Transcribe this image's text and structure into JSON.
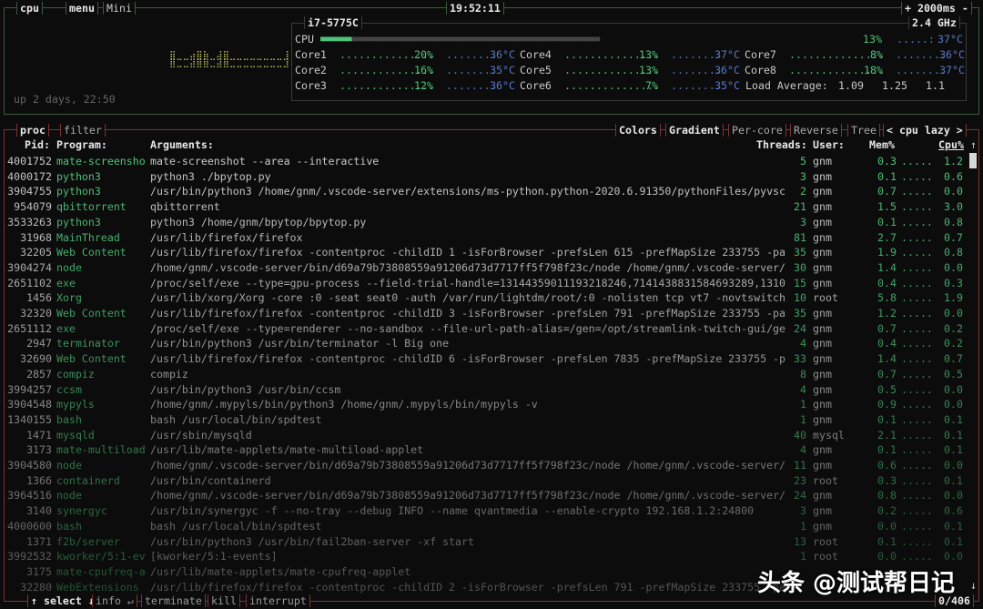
{
  "cpu_box": {
    "tab": "cpu",
    "menu": "menu",
    "mini": "Mini",
    "clock": "19:52:11",
    "interval": "+ 2000ms -",
    "uptime": "up 2 days, 22:50",
    "mini_graph": "⣿⣀⣀⣴⣿⣷⣀⣼⣿⣀⣀⣀⣀⣀⣀⣀⣀⣸"
  },
  "cpu_info": {
    "model": "i7-5775C",
    "freq": "2.4 GHz",
    "total": {
      "label": "CPU",
      "pct": "13%",
      "temp": "37°C",
      "bar_fill": 13
    },
    "cores": [
      {
        "label": "Core1",
        "pct": "20%",
        "temp": "36°C"
      },
      {
        "label": "Core2",
        "pct": "16%",
        "temp": "35°C"
      },
      {
        "label": "Core3",
        "pct": "12%",
        "temp": "36°C"
      },
      {
        "label": "Core4",
        "pct": "13%",
        "temp": "37°C"
      },
      {
        "label": "Core5",
        "pct": "13%",
        "temp": "36°C"
      },
      {
        "label": "Core6",
        "pct": "7%",
        "temp": "35°C"
      },
      {
        "label": "Core7",
        "pct": "8%",
        "temp": "36°C"
      },
      {
        "label": "Core8",
        "pct": "18%",
        "temp": "37°C"
      }
    ],
    "load_label": "Load Average:",
    "load": [
      "1.09",
      "1.25",
      "1.1"
    ]
  },
  "proc_box": {
    "tab": "proc",
    "filter": "filter",
    "options": [
      "Colors",
      "Gradient",
      "Per-core",
      "Reverse",
      "Tree"
    ],
    "sort": "< cpu lazy >",
    "headers": {
      "pid": "Pid:",
      "program": "Program:",
      "args": "Arguments:",
      "threads": "Threads:",
      "user": "User:",
      "mem": "Mem%",
      "cpu": "Cpu%",
      "sort_arrow": "↑"
    },
    "footer": {
      "select": "↑ select ↓",
      "info": "info ↵",
      "terminate": "terminate",
      "kill": "kill",
      "interrupt": "interrupt",
      "count": "0/406",
      "down_arrow": "↓"
    },
    "rows": [
      [
        "4001752",
        "mate-screensho",
        "mate-screenshot --area --interactive",
        "5",
        "gnm",
        "0.3",
        "1.2"
      ],
      [
        "4000172",
        "python3",
        "python3 ./bpytop.py",
        "3",
        "gnm",
        "0.1",
        "0.6"
      ],
      [
        "3904755",
        "python3",
        "/usr/bin/python3 /home/gnm/.vscode-server/extensions/ms-python.python-2020.6.91350/pythonFiles/pyvsc",
        "2",
        "gnm",
        "0.7",
        "0.0"
      ],
      [
        "954079",
        "qbittorrent",
        "qbittorrent",
        "21",
        "gnm",
        "1.5",
        "3.0"
      ],
      [
        "3533263",
        "python3",
        "python3 /home/gnm/bpytop/bpytop.py",
        "3",
        "gnm",
        "0.1",
        "0.8"
      ],
      [
        "31968",
        "MainThread",
        "/usr/lib/firefox/firefox",
        "81",
        "gnm",
        "2.7",
        "0.7"
      ],
      [
        "32205",
        "Web Content",
        "/usr/lib/firefox/firefox -contentproc -childID 1 -isForBrowser -prefsLen 615 -prefMapSize 233755 -pa",
        "35",
        "gnm",
        "1.9",
        "0.8"
      ],
      [
        "3904274",
        "node",
        "/home/gnm/.vscode-server/bin/d69a79b73808559a91206d73d7717ff5f798f23c/node /home/gnm/.vscode-server/",
        "30",
        "gnm",
        "1.4",
        "0.0"
      ],
      [
        "2651102",
        "exe",
        "/proc/self/exe --type=gpu-process --field-trial-handle=13144359011193218246,7141438831584693289,1310",
        "15",
        "gnm",
        "0.4",
        "0.3"
      ],
      [
        "1456",
        "Xorg",
        "/usr/lib/xorg/Xorg -core :0 -seat seat0 -auth /var/run/lightdm/root/:0 -nolisten tcp vt7 -novtswitch",
        "10",
        "root",
        "5.8",
        "1.9"
      ],
      [
        "32320",
        "Web Content",
        "/usr/lib/firefox/firefox -contentproc -childID 3 -isForBrowser -prefsLen 791 -prefMapSize 233755 -pa",
        "35",
        "gnm",
        "1.2",
        "0.0"
      ],
      [
        "2651112",
        "exe",
        "/proc/self/exe --type=renderer --no-sandbox --file-url-path-alias=/gen=/opt/streamlink-twitch-gui/ge",
        "24",
        "gnm",
        "0.7",
        "0.2"
      ],
      [
        "2947",
        "terminator",
        "/usr/bin/python3 /usr/bin/terminator -l Big one",
        "4",
        "gnm",
        "0.4",
        "0.2"
      ],
      [
        "32690",
        "Web Content",
        "/usr/lib/firefox/firefox -contentproc -childID 6 -isForBrowser -prefsLen 7835 -prefMapSize 233755 -p",
        "33",
        "gnm",
        "1.4",
        "0.7"
      ],
      [
        "2857",
        "compiz",
        "compiz",
        "8",
        "gnm",
        "0.7",
        "0.5"
      ],
      [
        "3994257",
        "ccsm",
        "/usr/bin/python3 /usr/bin/ccsm",
        "4",
        "gnm",
        "0.5",
        "0.0"
      ],
      [
        "3904548",
        "mypyls",
        "/home/gnm/.mypyls/bin/python3 /home/gnm/.mypyls/bin/mypyls -v",
        "1",
        "gnm",
        "0.9",
        "0.0"
      ],
      [
        "1340155",
        "bash",
        "bash /usr/local/bin/spdtest",
        "1",
        "gnm",
        "0.1",
        "0.1"
      ],
      [
        "1471",
        "mysqld",
        "/usr/sbin/mysqld",
        "40",
        "mysql",
        "2.1",
        "0.1"
      ],
      [
        "3173",
        "mate-multiload",
        "/usr/lib/mate-applets/mate-multiload-applet",
        "4",
        "gnm",
        "0.1",
        "0.1"
      ],
      [
        "3904580",
        "node",
        "/home/gnm/.vscode-server/bin/d69a79b73808559a91206d73d7717ff5f798f23c/node /home/gnm/.vscode-server/",
        "11",
        "gnm",
        "0.6",
        "0.0"
      ],
      [
        "1366",
        "containerd",
        "/usr/bin/containerd",
        "23",
        "root",
        "0.3",
        "0.1"
      ],
      [
        "3964516",
        "node",
        "/home/gnm/.vscode-server/bin/d69a79b73808559a91206d73d7717ff5f798f23c/node /home/gnm/.vscode-server/",
        "24",
        "gnm",
        "0.8",
        "0.0"
      ],
      [
        "3140",
        "synergyc",
        "/usr/bin/synergyc -f --no-tray --debug INFO --name qvantmedia --enable-crypto 192.168.1.2:24800",
        "3",
        "gnm",
        "0.2",
        "0.6"
      ],
      [
        "4000600",
        "bash",
        "bash /usr/local/bin/spdtest",
        "1",
        "gnm",
        "0.0",
        "0.1"
      ],
      [
        "1371",
        "f2b/server",
        "/usr/bin/python3 /usr/bin/fail2ban-server -xf start",
        "13",
        "root",
        "0.1",
        "0.1"
      ],
      [
        "3992532",
        "kworker/5:1-ev",
        "[kworker/5:1-events]",
        "1",
        "root",
        "0.0",
        "0.0"
      ],
      [
        "3175",
        "mate-cpufreq-a",
        "/usr/lib/mate-applets/mate-cpufreq-applet",
        "",
        "",
        "",
        ""
      ],
      [
        "32280",
        "WebExtensions",
        "/usr/lib/firefox/firefox -contentproc -childID 2 -isForBrowser -prefsLen 791 -prefMapSize 233755 -pa",
        "",
        "",
        "",
        ""
      ]
    ]
  },
  "watermark": "头条 @测试帮日记",
  "colors": {
    "program": "#4fc47a",
    "temp": "#5878c8",
    "cpu_border": "#3c5a3c",
    "proc_border": "#7a3434"
  }
}
